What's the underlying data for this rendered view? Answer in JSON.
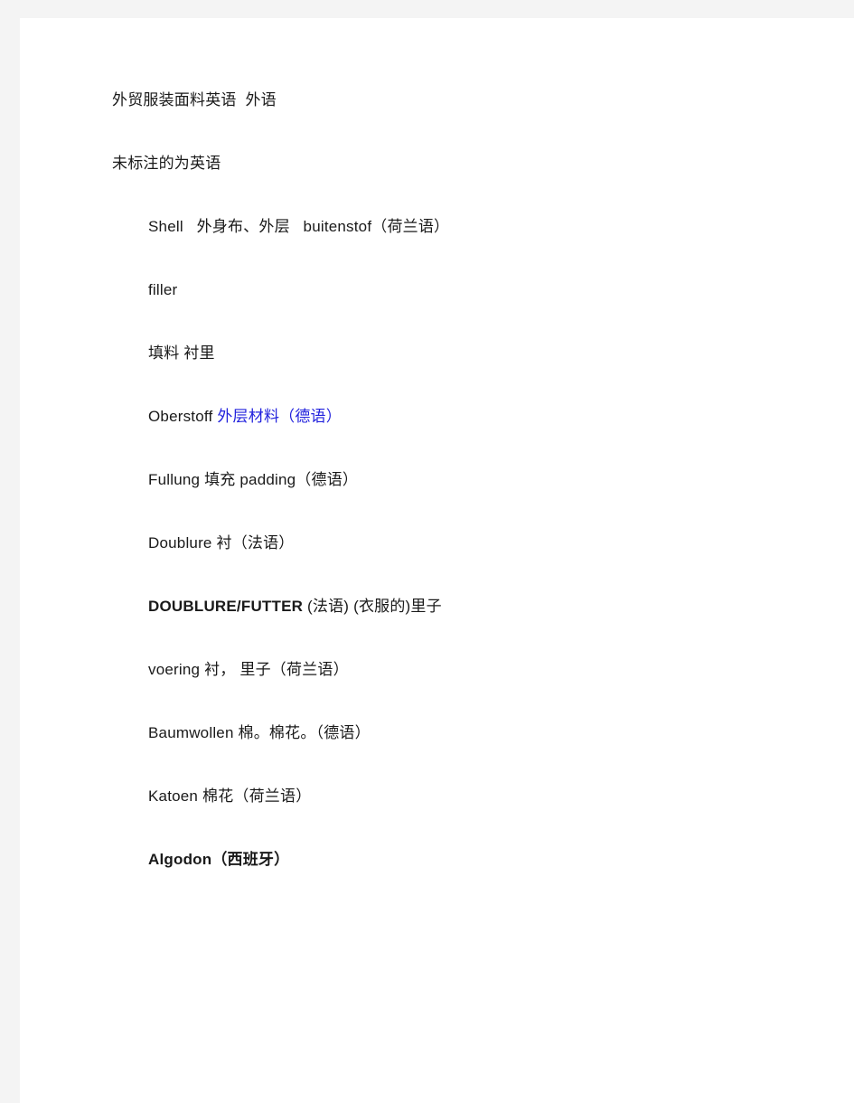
{
  "page": {
    "background_color": "#f4f4f4",
    "sheet_color": "#ffffff",
    "text_color": "#1a1a1a",
    "accent_color": "#2222dd"
  },
  "document": {
    "paragraphs": [
      {
        "name": "paragraph-title",
        "indented": false,
        "segments": [
          {
            "text": "外贸服装面料英语  外语",
            "style": "normal"
          }
        ]
      },
      {
        "name": "paragraph-note",
        "indented": false,
        "segments": [
          {
            "text": "未标注的为英语",
            "style": "normal"
          }
        ]
      },
      {
        "name": "paragraph-shell",
        "indented": true,
        "segments": [
          {
            "text": "Shell   外身布、外层   buitenstof（荷兰语）",
            "style": "normal"
          }
        ]
      },
      {
        "name": "paragraph-filler",
        "indented": true,
        "segments": [
          {
            "text": "filler",
            "style": "normal"
          }
        ]
      },
      {
        "name": "paragraph-tianliao-chenli",
        "indented": true,
        "segments": [
          {
            "text": "填料 衬里",
            "style": "normal"
          }
        ]
      },
      {
        "name": "paragraph-oberstoff",
        "indented": true,
        "segments": [
          {
            "text": "Oberstoff ",
            "style": "normal"
          },
          {
            "text": "外层材料（德语）",
            "style": "blue"
          }
        ]
      },
      {
        "name": "paragraph-fullung",
        "indented": true,
        "segments": [
          {
            "text": "Fullung 填充 padding（德语）",
            "style": "normal"
          }
        ]
      },
      {
        "name": "paragraph-doublure",
        "indented": true,
        "segments": [
          {
            "text": "Doublure 衬（法语）",
            "style": "normal"
          }
        ]
      },
      {
        "name": "paragraph-doublure-futter",
        "indented": true,
        "segments": [
          {
            "text": "DOUBLURE/FUTTER",
            "style": "bold"
          },
          {
            "text": " (法语) (衣服的)里子",
            "style": "normal"
          }
        ]
      },
      {
        "name": "paragraph-voering",
        "indented": true,
        "segments": [
          {
            "text": "voering 衬， 里子（荷兰语）",
            "style": "normal"
          }
        ]
      },
      {
        "name": "paragraph-baumwollen",
        "indented": true,
        "segments": [
          {
            "text": "Baumwollen 棉。棉花。（德语）",
            "style": "normal"
          }
        ]
      },
      {
        "name": "paragraph-katoen",
        "indented": true,
        "segments": [
          {
            "text": "Katoen 棉花（荷兰语）",
            "style": "normal"
          }
        ]
      },
      {
        "name": "paragraph-algodon",
        "indented": true,
        "segments": [
          {
            "text": "Algodon（西班牙）",
            "style": "bold"
          }
        ]
      }
    ]
  }
}
